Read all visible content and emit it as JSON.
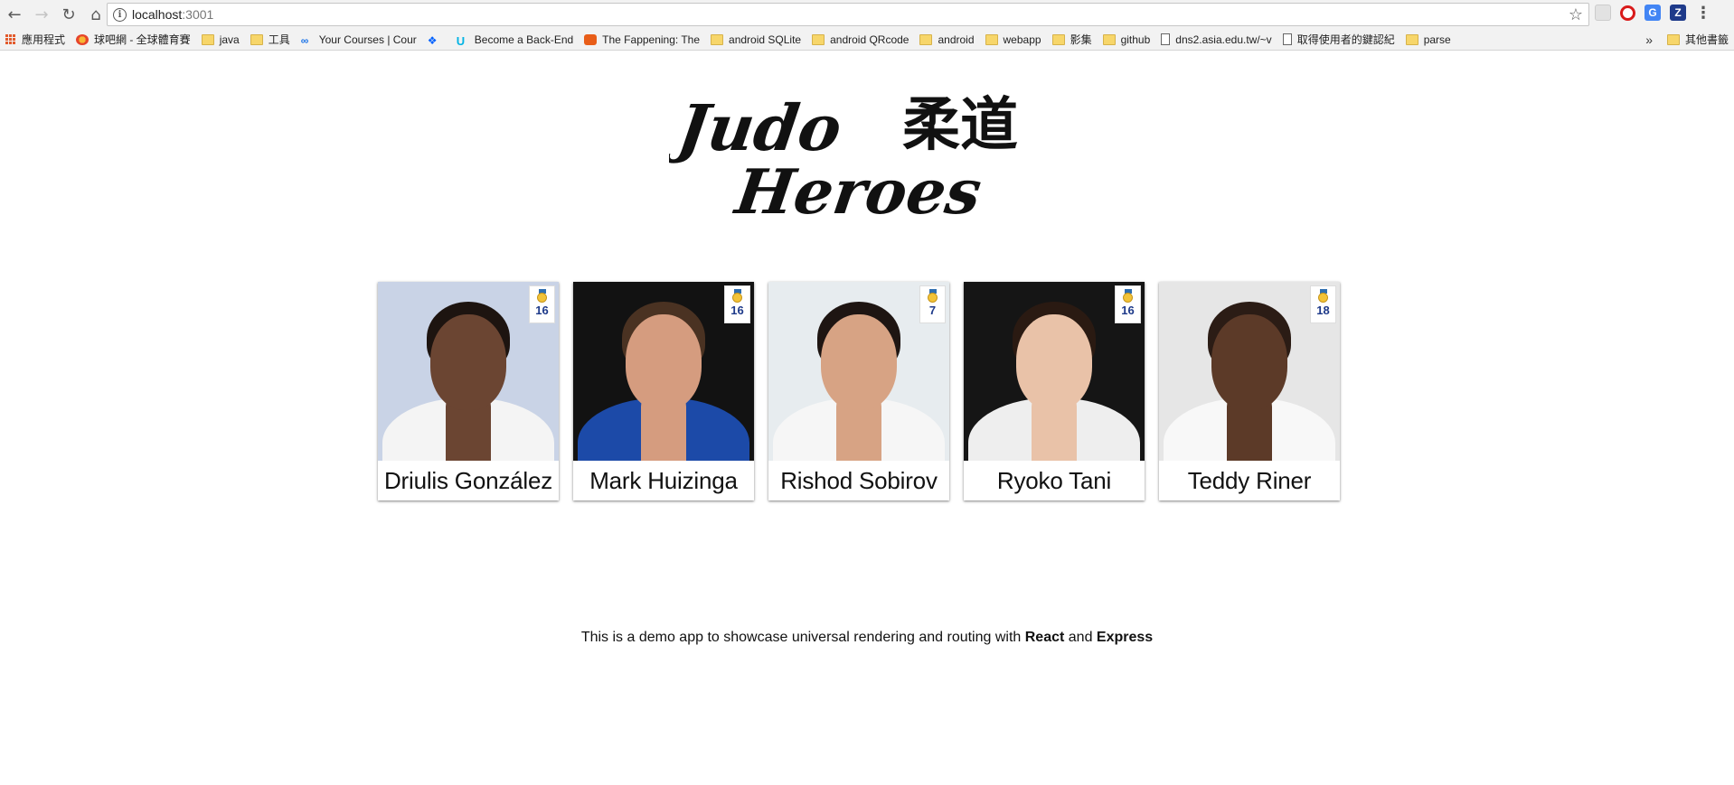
{
  "browser": {
    "url_host": "localhost",
    "url_port": ":3001"
  },
  "bookmarks": [
    {
      "label": "應用程式",
      "icon": "apps-icon"
    },
    {
      "label": "球吧網 - 全球體育賽",
      "icon": "ball-icon"
    },
    {
      "label": "java",
      "icon": "folder-icon"
    },
    {
      "label": "工具",
      "icon": "folder-icon"
    },
    {
      "label": "Your Courses | Cour",
      "icon": "link-icon"
    },
    {
      "label": "",
      "icon": "dropbox-icon"
    },
    {
      "label": "Become a Back-End",
      "icon": "udacity-icon"
    },
    {
      "label": "The Fappening: The",
      "icon": "fap-icon"
    },
    {
      "label": "android SQLite",
      "icon": "folder-icon"
    },
    {
      "label": "android QRcode",
      "icon": "folder-icon"
    },
    {
      "label": "android",
      "icon": "folder-icon"
    },
    {
      "label": "webapp",
      "icon": "folder-icon"
    },
    {
      "label": "影集",
      "icon": "folder-icon"
    },
    {
      "label": "github",
      "icon": "folder-icon"
    },
    {
      "label": "dns2.asia.edu.tw/~v",
      "icon": "page-icon"
    },
    {
      "label": "取得使用者的鍵認紀",
      "icon": "page-icon"
    },
    {
      "label": "parse",
      "icon": "folder-icon"
    }
  ],
  "other_bookmarks": "其他書籤",
  "overflow_chevron": "»",
  "logo": {
    "line1": "Judo",
    "kanji": "柔道",
    "line2": "Heroes"
  },
  "athletes": [
    {
      "name": "Driulis González",
      "medals": "16",
      "skin": "#6b4532",
      "bg": "#c9d3e6",
      "uniform": "#f4f4f4",
      "hair": "#1d1410"
    },
    {
      "name": "Mark Huizinga",
      "medals": "16",
      "skin": "#d59c7f",
      "bg": "#121212",
      "uniform": "#1c4aa8",
      "hair": "#4a3222"
    },
    {
      "name": "Rishod Sobirov",
      "medals": "7",
      "skin": "#d7a384",
      "bg": "#e7ecef",
      "uniform": "#f6f6f6",
      "hair": "#1e1512"
    },
    {
      "name": "Ryoko Tani",
      "medals": "16",
      "skin": "#e9c2a8",
      "bg": "#151515",
      "uniform": "#eeeeee",
      "hair": "#2a1a12"
    },
    {
      "name": "Teddy Riner",
      "medals": "18",
      "skin": "#5c3a28",
      "bg": "#e6e6e6",
      "uniform": "#f8f8f8",
      "hair": "#2b1c15"
    }
  ],
  "footer": {
    "prefix": "This is a demo app to showcase universal rendering and routing with ",
    "react": "React",
    "and": " and ",
    "express": "Express"
  }
}
